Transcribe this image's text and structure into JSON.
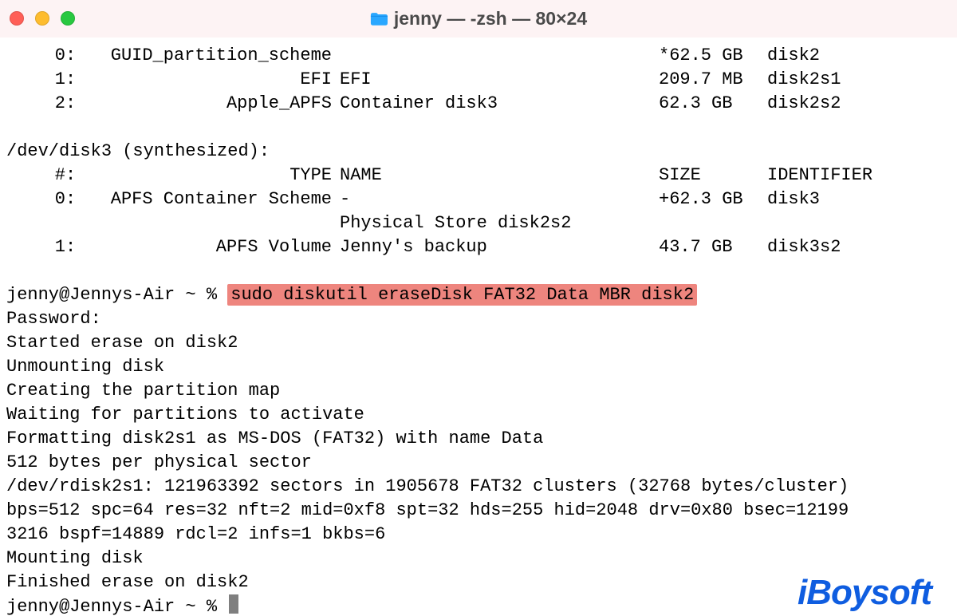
{
  "title": "jenny — -zsh — 80×24",
  "traffic": {
    "close": "close",
    "min": "minimize",
    "max": "maximize"
  },
  "disk2_rows": [
    {
      "idx": "0",
      "type": "GUID_partition_scheme",
      "name": "",
      "size": "*62.5 GB",
      "id": "disk2"
    },
    {
      "idx": "1",
      "type": "EFI",
      "name": "EFI",
      "size": "209.7 MB",
      "id": "disk2s1"
    },
    {
      "idx": "2",
      "type": "Apple_APFS",
      "name": "Container disk3",
      "size": "62.3 GB",
      "id": "disk2s2"
    }
  ],
  "disk3_header": "/dev/disk3 (synthesized):",
  "disk3_cols": {
    "idx": "#",
    "type": "TYPE",
    "name": "NAME",
    "size": "SIZE",
    "id": "IDENTIFIER"
  },
  "disk3_rows": [
    {
      "idx": "0",
      "type": "APFS Container Scheme",
      "name": "-",
      "size": "+62.3 GB",
      "id": "disk3"
    },
    {
      "idx": "",
      "type": "",
      "name": "Physical Store disk2s2",
      "size": "",
      "id": ""
    },
    {
      "idx": "1",
      "type": "APFS Volume",
      "name": "Jenny's backup",
      "size": "43.7 GB",
      "id": "disk3s2"
    }
  ],
  "prompt": "jenny@Jennys-Air ~ % ",
  "command": "sudo diskutil eraseDisk FAT32 Data MBR disk2",
  "lines": [
    "Password:",
    "Started erase on disk2",
    "Unmounting disk",
    "Creating the partition map",
    "Waiting for partitions to activate",
    "Formatting disk2s1 as MS-DOS (FAT32) with name Data",
    "512 bytes per physical sector",
    "/dev/rdisk2s1: 121963392 sectors in 1905678 FAT32 clusters (32768 bytes/cluster)",
    "bps=512 spc=64 res=32 nft=2 mid=0xf8 spt=32 hds=255 hid=2048 drv=0x80 bsec=12199",
    "3216 bspf=14889 rdcl=2 infs=1 bkbs=6",
    "Mounting disk",
    "Finished erase on disk2"
  ],
  "prompt_end": "jenny@Jennys-Air ~ % ",
  "watermark": "iBoysoft"
}
